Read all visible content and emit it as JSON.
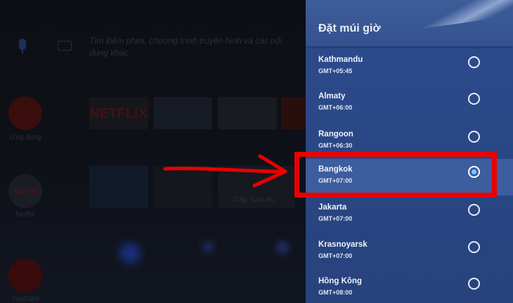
{
  "background": {
    "search_placeholder": "Tìm kiếm phim, chương trình truyền hình và các nội dung khác",
    "tiles": [
      "NETFLIX"
    ],
    "apps": [
      {
        "label": "Ứng dụng"
      },
      {
        "label": "Netflix",
        "icon_text": "NETFLIX"
      },
      {
        "label": "YouTube"
      }
    ],
    "row2_text": "Cặp Sao Ác"
  },
  "panel": {
    "title": "Đặt múi giờ",
    "items": [
      {
        "name": "Kathmandu",
        "offset": "GMT+05:45",
        "selected": false
      },
      {
        "name": "Almaty",
        "offset": "GMT+06:00",
        "selected": false
      },
      {
        "name": "Rangoon",
        "offset": "GMT+06:30",
        "selected": false
      },
      {
        "name": "Bangkok",
        "offset": "GMT+07:00",
        "selected": true
      },
      {
        "name": "Jakarta",
        "offset": "GMT+07:00",
        "selected": false
      },
      {
        "name": "Krasnoyarsk",
        "offset": "GMT+07:00",
        "selected": false
      },
      {
        "name": "Hồng Kông",
        "offset": "GMT+08:00",
        "selected": false
      }
    ]
  },
  "colors": {
    "panel_bg": "#2a4785",
    "selected_row": "#3c5d9e",
    "radio_selected": "#7fc6ff",
    "annotation": "#ea0000"
  },
  "icons": [
    "microphone-icon",
    "keyboard-icon",
    "apps-grid-icon",
    "netflix-icon",
    "youtube-icon",
    "radio-button-icon",
    "annotation-arrow-icon"
  ]
}
